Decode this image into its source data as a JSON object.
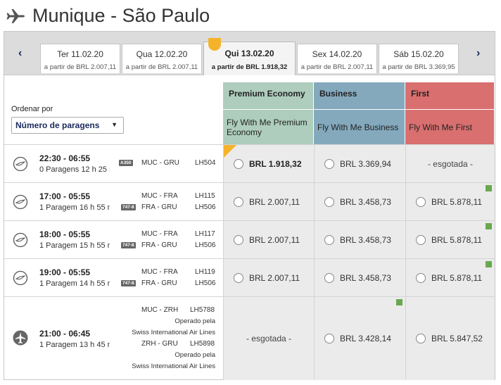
{
  "header": {
    "title": "Munique - São Paulo",
    "icon": "plane-icon"
  },
  "date_tabs": {
    "prev_icon": "‹",
    "next_icon": "›",
    "tabs": [
      {
        "date": "Ter 11.02.20",
        "price": "a partir de  BRL 2.007,11",
        "selected": false
      },
      {
        "date": "Qua 12.02.20",
        "price": "a partir de  BRL 2.007,11",
        "selected": false
      },
      {
        "date": "Qui 13.02.20",
        "price": "a partir de  BRL 1.918,32",
        "selected": true
      },
      {
        "date": "Sex 14.02.20",
        "price": "a partir de  BRL 2.007,11",
        "selected": false
      },
      {
        "date": "Sáb 15.02.20",
        "price": "a partir de  BRL 3.369,95",
        "selected": false
      }
    ]
  },
  "sort": {
    "label": "Ordenar por",
    "value": "Número de paragens"
  },
  "cabins": [
    {
      "name": "Premium Economy",
      "fare": "Fly With Me Premium Economy",
      "color": "#aecdbd"
    },
    {
      "name": "Business",
      "fare": "Fly With Me Business",
      "color": "#84a9bd"
    },
    {
      "name": "First",
      "fare": "Fly With Me First",
      "color": "#d96f6f"
    }
  ],
  "flights": [
    {
      "times": "22:30 - 06:55",
      "duration": "0 Paragens 12 h 25 m",
      "aircraft": "A350",
      "segments": [
        {
          "route": "MUC - GRU",
          "flight": "LH504"
        }
      ],
      "prices": [
        "BRL 1.918,32",
        "BRL 3.369,94",
        "- esgotada -"
      ]
    },
    {
      "times": "17:00 - 05:55",
      "duration": "1 Paragem 16 h 55 m",
      "aircraft": "747-8",
      "segments": [
        {
          "route": "MUC - FRA",
          "flight": "LH115"
        },
        {
          "route": "FRA - GRU",
          "flight": "LH506"
        }
      ],
      "prices": [
        "BRL 2.007,11",
        "BRL 3.458,73",
        "BRL 5.878,11"
      ]
    },
    {
      "times": "18:00 - 05:55",
      "duration": "1 Paragem 15 h 55 m",
      "aircraft": "747-8",
      "segments": [
        {
          "route": "MUC - FRA",
          "flight": "LH117"
        },
        {
          "route": "FRA - GRU",
          "flight": "LH506"
        }
      ],
      "prices": [
        "BRL 2.007,11",
        "BRL 3.458,73",
        "BRL 5.878,11"
      ]
    },
    {
      "times": "19:00 - 05:55",
      "duration": "1 Paragem 14 h 55 m",
      "aircraft": "747-8",
      "segments": [
        {
          "route": "MUC - FRA",
          "flight": "LH119"
        },
        {
          "route": "FRA - GRU",
          "flight": "LH506"
        }
      ],
      "prices": [
        "BRL 2.007,11",
        "BRL 3.458,73",
        "BRL 5.878,11"
      ]
    },
    {
      "times": "21:00 - 06:45",
      "duration": "1 Paragem 13 h 45 m",
      "segments": [
        {
          "route": "MUC - ZRH",
          "flight": "LH5788",
          "op_label": "Operado pela",
          "op_by": "Swiss International Air Lines"
        },
        {
          "route": "ZRH - GRU",
          "flight": "LH5898",
          "op_label": "Operado pela",
          "op_by": "Swiss International Air Lines"
        }
      ],
      "prices": [
        "- esgotada -",
        "BRL 3.428,14",
        "BRL 5.847,52"
      ]
    }
  ]
}
